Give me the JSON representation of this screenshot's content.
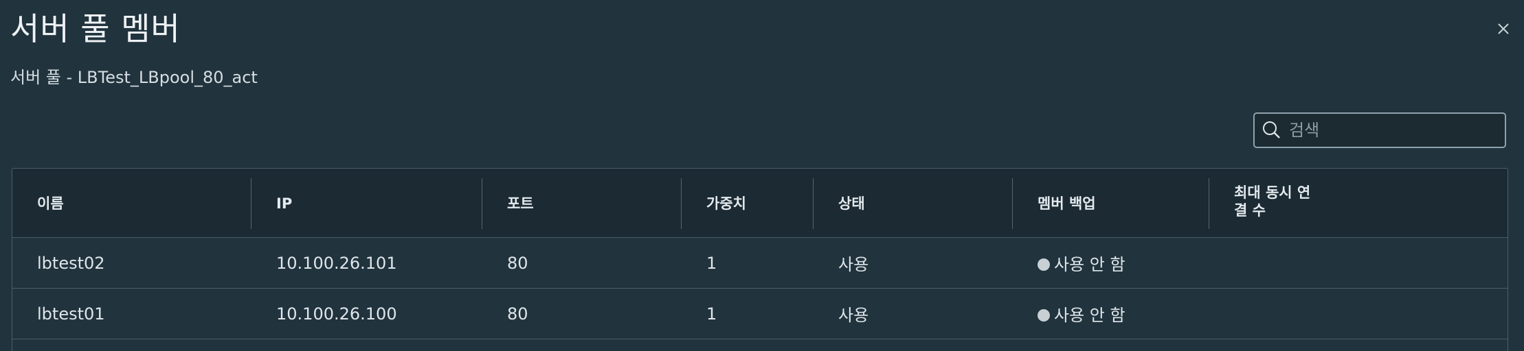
{
  "dialog": {
    "title": "서버 풀 멤버",
    "subtitle": "서버 풀 - LBTest_LBpool_80_act",
    "close_icon": "close-icon"
  },
  "search": {
    "placeholder": "검색",
    "value": "",
    "icon": "search-icon"
  },
  "table": {
    "columns": [
      "이름",
      "IP",
      "포트",
      "가중치",
      "상태",
      "멤버 백업",
      "최대 동시 연\n결 수"
    ],
    "columns_split": {
      "max_conn_line1": "최대 동시 연",
      "max_conn_line2": "결 수"
    },
    "rows": [
      {
        "name": "lbtest02",
        "ip": "10.100.26.101",
        "port": "80",
        "weight": "1",
        "state": "사용",
        "backup": "사용 안 함",
        "max_conn": ""
      },
      {
        "name": "lbtest01",
        "ip": "10.100.26.100",
        "port": "80",
        "weight": "1",
        "state": "사용",
        "backup": "사용 안 함",
        "max_conn": ""
      }
    ]
  },
  "colors": {
    "background": "#21333d",
    "header_bg": "#1b2a33",
    "border": "#4c5f69",
    "status_dot": "#c8d0d5"
  }
}
